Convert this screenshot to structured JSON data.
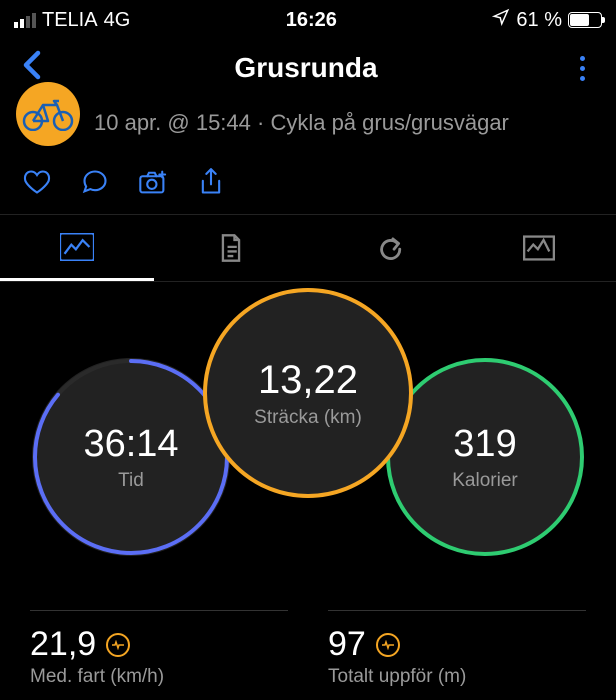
{
  "status": {
    "carrier": "TELIA",
    "network": "4G",
    "time": "16:26",
    "battery_pct": "61 %"
  },
  "nav": {
    "title": "Grusrunda"
  },
  "header": {
    "subtitle": "10 apr. @ 15:44 · Cykla på grus/grusvägar"
  },
  "rings": {
    "center": {
      "value": "13,22",
      "label": "Sträcka (km)"
    },
    "left": {
      "value": "36:14",
      "label": "Tid"
    },
    "right": {
      "value": "319",
      "label": "Kalorier"
    }
  },
  "stats": {
    "speed": {
      "value": "21,9",
      "label": "Med. fart (km/h)"
    },
    "ascent": {
      "value": "97",
      "label": "Totalt uppför (m)"
    }
  }
}
